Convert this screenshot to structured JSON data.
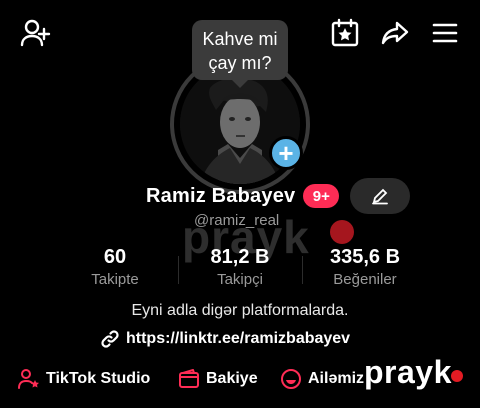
{
  "bubble": {
    "line1": "Kahve mi",
    "line2": "çay mı?"
  },
  "profile": {
    "name": "Ramiz Babayev",
    "notif_badge": "9+",
    "username": "@ramiz_real"
  },
  "stats": [
    {
      "value": "60",
      "label": "Takipte"
    },
    {
      "value": "81,2 B",
      "label": "Takipçi"
    },
    {
      "value": "335,6 B",
      "label": "Beğeniler"
    }
  ],
  "bio": "Eyni adla digər platformalarda.",
  "link": "https://linktr.ee/ramizbabayev",
  "quick_links": [
    {
      "label": "TikTok Studio"
    },
    {
      "label": "Bakiye"
    },
    {
      "label": "Ailəmiz"
    }
  ],
  "watermark": "prayk",
  "colors": {
    "accent": "#fe2c55",
    "add_badge": "#5ab3e6",
    "bubble": "#3b3b3b"
  }
}
